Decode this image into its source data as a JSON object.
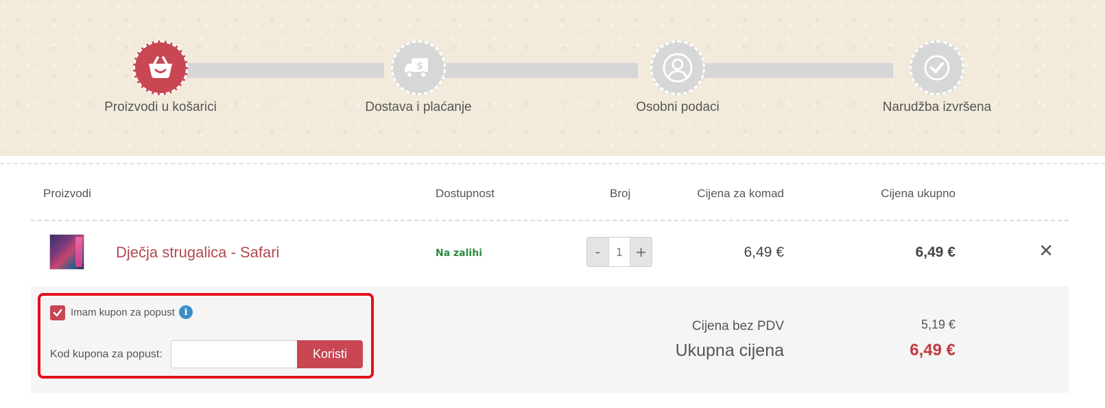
{
  "steps": [
    {
      "label": "Proizvodi u košarici",
      "icon": "basket-icon",
      "active": true
    },
    {
      "label": "Dostava i plaćanje",
      "icon": "delivery-truck-icon",
      "active": false
    },
    {
      "label": "Osobni podaci",
      "icon": "user-icon",
      "active": false
    },
    {
      "label": "Narudžba izvršena",
      "icon": "checkmark-icon",
      "active": false
    }
  ],
  "table": {
    "headers": {
      "products": "Proizvodi",
      "availability": "Dostupnost",
      "quantity": "Broj",
      "unit_price": "Cijena za komad",
      "total_price": "Cijena ukupno"
    },
    "items": [
      {
        "name": "Dječja strugalica - Safari",
        "availability": "Na zalihi",
        "quantity": "1",
        "unit_price": "6,49 €",
        "total_price": "6,49 €",
        "minus": "-",
        "plus": "+",
        "remove": "✕"
      }
    ]
  },
  "coupon": {
    "checkbox_label": "Imam kupon za popust",
    "info": "i",
    "code_label": "Kod kupona za popust:",
    "code_value": "",
    "button": "Koristi"
  },
  "summary": {
    "net_label": "Cijena bez PDV",
    "net_value": "5,19 €",
    "total_label": "Ukupna cijena",
    "total_value": "6,49 €"
  },
  "colors": {
    "accent": "#c94653",
    "highlight_border": "#e2101a",
    "in_stock": "#2d8a3a",
    "total": "#c23a3f"
  }
}
